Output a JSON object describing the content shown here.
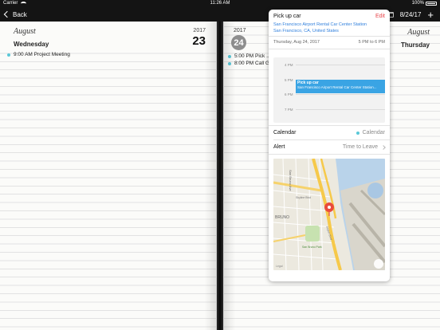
{
  "status": {
    "carrier": "Carrier",
    "time": "11:26 AM",
    "battery": "100%"
  },
  "nav": {
    "back_label": "Back",
    "date": "8/24/17",
    "add_label": "+"
  },
  "left_page": {
    "month": "August",
    "year": "2017",
    "weekday": "Wednesday",
    "day": "23",
    "events": [
      {
        "time": "9:00 AM",
        "title": "Project Meeting"
      }
    ]
  },
  "right_page": {
    "month": "August",
    "year": "2017",
    "weekday": "Thursday",
    "day": "24",
    "events": [
      {
        "text": "5:00 PM Pick ..."
      },
      {
        "text": "8:00 PM Call Ga..."
      }
    ]
  },
  "popover": {
    "title": "Pick up car",
    "edit_label": "Edit",
    "location_line1": "San Francisco Airport Rental Car Center Station",
    "location_line2": "San Francisco, CA, United States",
    "date": "Thursday, Aug 24, 2017",
    "time_range": "5 PM to 6 PM",
    "timeline": {
      "labels": [
        "4 PM",
        "5 PM",
        "6 PM",
        "7 PM"
      ],
      "event_title": "Pick up car",
      "event_location": "San Francisco Airport Rental Car Center Station..."
    },
    "calendar_label": "Calendar",
    "calendar_value": "Calendar",
    "alert_label": "Alert",
    "alert_value": "Time to Leave",
    "map": {
      "labels": [
        "San Bruno Ave",
        "BRUNO",
        "San Bruno Park",
        "Skyline Blvd",
        "Airport Blvd"
      ],
      "legal": "Legal"
    }
  },
  "colors": {
    "accent_red": "#e8474c",
    "link_blue": "#2f7fdc",
    "event_blue": "#3aa4e4",
    "calendar_dot": "#5ac8d8",
    "pin_red": "#e94b3c"
  }
}
